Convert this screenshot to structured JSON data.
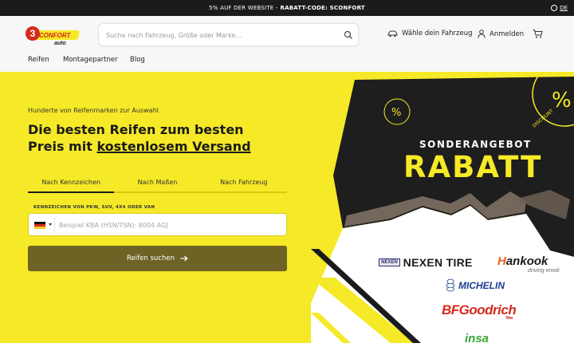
{
  "promo_bar": {
    "text": "5% AUF DER WEBSITE -",
    "code_label": "RABATT-CODE: SCONFORT"
  },
  "language": {
    "code": "DE",
    "icon": "globe-icon"
  },
  "header": {
    "logo": {
      "line1": "CONFORT",
      "line2": "auto",
      "digit": "3"
    },
    "search": {
      "placeholder": "Suche nach Fahrzeug, Größe oder Marke...",
      "value": ""
    },
    "vehicle_link": "Wähle dein Fahrzeug",
    "login_link": "Anmelden"
  },
  "nav": {
    "items": [
      "Reifen",
      "Montagepartner",
      "Blog"
    ]
  },
  "hero": {
    "subtitle": "Hunderte von Reifenmarken zur Auswahl",
    "title_part1": "Die besten Reifen zum besten Preis mit",
    "title_link": "kostenlosem Versand",
    "tabs": [
      {
        "label": "Nach Kennzeichen",
        "active": true
      },
      {
        "label": "Nach Maßen",
        "active": false
      },
      {
        "label": "Nach Fahrzeug",
        "active": false
      }
    ],
    "field_label": "KENNZEICHEN VON PKW, SUV, 4X4 ODER VAN",
    "input_placeholder": "Beispiel KBA (HSN/TSN): 8004 AGJ",
    "input_value": "",
    "submit_label": "Reifen suchen"
  },
  "banner": {
    "special_offer": "SONDERANGEBOT",
    "discount": "RABATT",
    "seal_text": "DISCOUNT",
    "brands": {
      "nexen_badge": "NEXEN",
      "nexen": "NEXEN TIRE",
      "hankook_w": "H",
      "hankook": "ankook",
      "hankook_tagline": "driving emoti",
      "michelin": "MICHELIN",
      "bfgoodrich": "BFGoodrich",
      "bfgoodrich_sub": "Tires",
      "insa": "insa"
    }
  },
  "colors": {
    "accent_yellow": "#f6e927",
    "submit_olive": "#6e6325",
    "dark": "#1b1b1b",
    "brand_red": "#d52b1e"
  }
}
